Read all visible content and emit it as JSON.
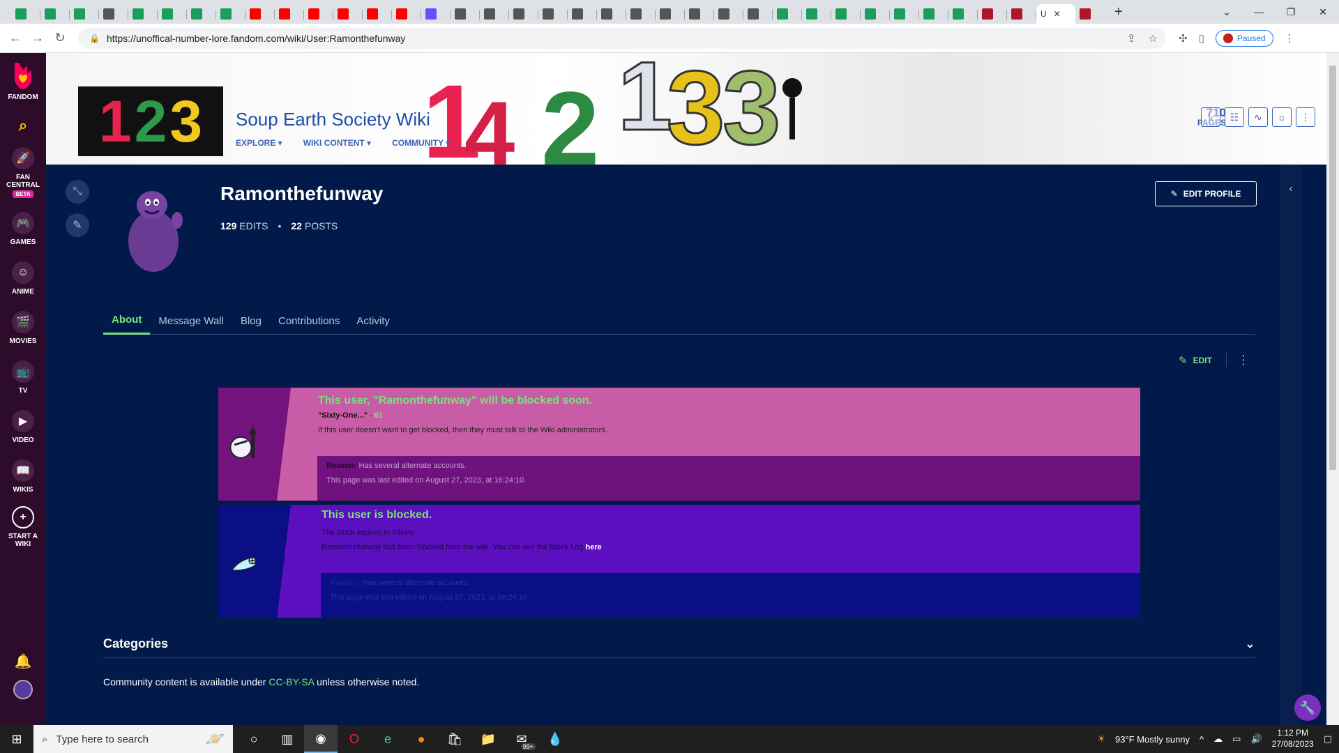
{
  "browser": {
    "tab_favicons": [
      "#1a9e5c",
      "#1a9e5c",
      "#1a9e5c",
      "#555555",
      "#1a9e5c",
      "#1a9e5c",
      "#1a9e5c",
      "#1a9e5c",
      "#ff0000",
      "#ff0000",
      "#ff0000",
      "#ff0000",
      "#ff0000",
      "#ff0000",
      "#6a4cff",
      "#555555",
      "#555555",
      "#555555",
      "#555555",
      "#555555",
      "#555555",
      "#555555",
      "#555555",
      "#555555",
      "#555555",
      "#555555",
      "#1a9e5c",
      "#1a9e5c",
      "#1a9e5c",
      "#1a9e5c",
      "#1a9e5c",
      "#1a9e5c",
      "#1a9e5c",
      "#b0142a",
      "#b0142a"
    ],
    "active_tab_label": "U",
    "active_tab_close": "✕",
    "new_tab": "+",
    "url": "https://unoffical-number-lore.fandom.com/wiki/User:Ramonthefunway",
    "profile_status": "Paused"
  },
  "rail": {
    "fandom": "FANDOM",
    "fan_central": "FAN CENTRAL",
    "beta": "BETA",
    "games": "GAMES",
    "anime": "ANIME",
    "movies": "MOVIES",
    "tv": "TV",
    "video": "VIDEO",
    "wikis": "WIKIS",
    "start_wiki": "START A WIKI"
  },
  "header": {
    "logo_digits": [
      "1",
      "2",
      "3"
    ],
    "wiki_title": "Soup Earth Society Wiki",
    "nav": [
      "EXPLORE ▾",
      "WIKI CONTENT ▾",
      "COMMUNITY ▾"
    ],
    "pages_count": "710",
    "pages_label": "PAGES"
  },
  "profile": {
    "username": "Ramonthefunway",
    "edits_count": "129",
    "edits_label": "EDITS",
    "posts_count": "22",
    "posts_label": "POSTS",
    "edit_profile": "EDIT PROFILE"
  },
  "tabs": [
    "About",
    "Message Wall",
    "Blog",
    "Contributions",
    "Activity"
  ],
  "content": {
    "edit_label": "EDIT",
    "notice1": {
      "title": "This user, \"Ramonthefunway\" will be blocked soon.",
      "quote": "\"Sixty-One...\"",
      "quote_sep": " - ",
      "quote_author": "61",
      "line": "If this user doesn't want to get blocked, then they must talk to the Wiki administrators.",
      "reason_label": "Reason:",
      "reason": "Has several alternate accounts.",
      "edited": "This page was last edited on August 27, 2023, at 16:24:10."
    },
    "notice2": {
      "title": "This user is blocked.",
      "expires": "The block expires in Infinite",
      "line_before": "Ramonthefunway has been blocked from the wiki. You can see the Block Log ",
      "line_link": "here",
      "reason_label": "Reason:",
      "reason": "Has several alternate accounts.",
      "edited": "This page was last edited on August 27, 2023, at 16:24:10."
    },
    "categories": "Categories",
    "license_before": "Community content is available under ",
    "license_link": "CC-BY-SA",
    "license_after": " unless otherwise noted."
  },
  "taskbar": {
    "search_placeholder": "Type here to search",
    "mail_badge": "99+",
    "weather": "93°F  Mostly sunny",
    "time": "1:12 PM",
    "date": "27/08/2023"
  },
  "colors": {
    "accent_green": "#7de07d",
    "page_bg": "#021a4a",
    "rail_bg": "#2c0b2b"
  }
}
